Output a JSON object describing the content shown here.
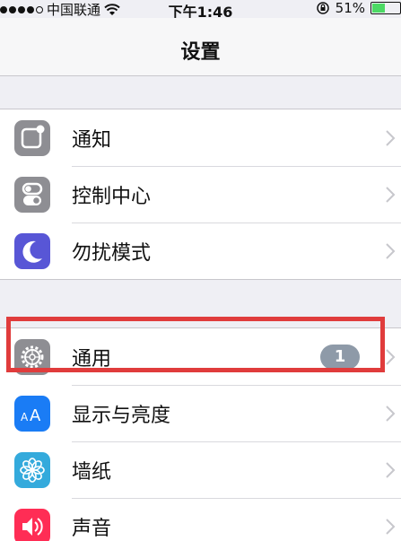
{
  "status_bar": {
    "carrier": "中国联通",
    "time": "下午1:46",
    "battery_percent": "51%",
    "battery_level": 0.51,
    "signal_bars_filled": 4,
    "signal_bars_total": 5
  },
  "nav": {
    "title": "设置"
  },
  "groups": [
    {
      "items": [
        {
          "label": "通知",
          "icon": "notifications-icon",
          "icon_color": "#8e8e93"
        },
        {
          "label": "控制中心",
          "icon": "control-center-icon",
          "icon_color": "#8e8e93"
        },
        {
          "label": "勿扰模式",
          "icon": "moon-icon",
          "icon_color": "#5856d6"
        }
      ]
    },
    {
      "items": [
        {
          "label": "通用",
          "icon": "gear-icon",
          "icon_color": "#8e8e93",
          "badge": "1"
        },
        {
          "label": "显示与亮度",
          "icon": "display-brightness-icon",
          "icon_color": "#1a7cf5"
        },
        {
          "label": "墙纸",
          "icon": "wallpaper-icon",
          "icon_color": "#34aadc"
        },
        {
          "label": "声音",
          "icon": "sound-icon",
          "icon_color": "#ff2d55"
        }
      ]
    }
  ],
  "colors": {
    "highlight": "#e03c3c",
    "badge": "#8e9aa8",
    "battery_fill": "#4cd964"
  }
}
